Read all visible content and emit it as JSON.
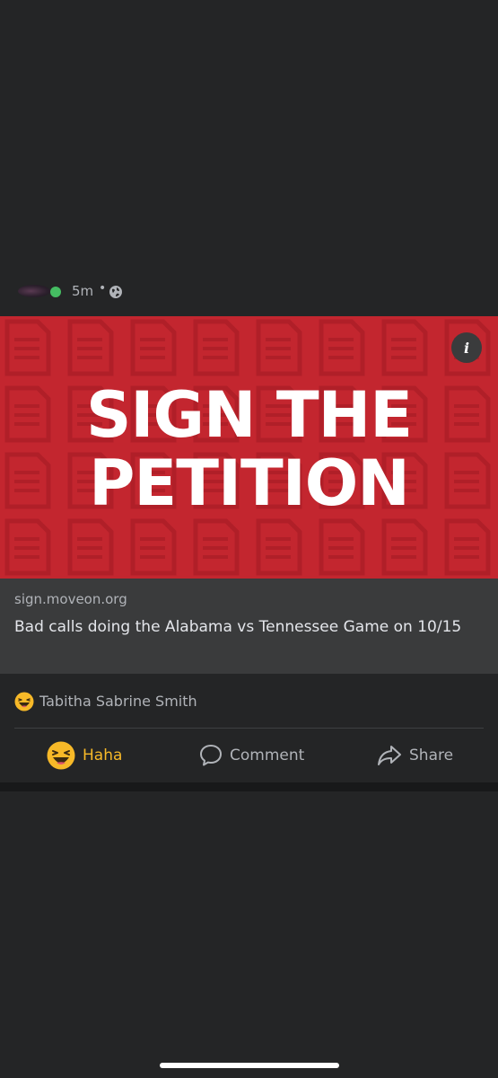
{
  "post": {
    "timestamp": "5m",
    "separator": "•",
    "privacy_icon": "globe-icon",
    "online_color": "#45bd62"
  },
  "banner": {
    "line1": "SIGN THE",
    "line2": "PETITION",
    "background": "#c3262f",
    "info_icon": "i"
  },
  "link": {
    "domain": "sign.moveon.org",
    "title": "Bad calls doing the Alabama vs Tennessee Game on 10/15"
  },
  "reactions": {
    "icon": "haha-emoji-icon",
    "names": "Tabitha Sabrine Smith"
  },
  "actions": {
    "haha_label": "Haha",
    "comment_label": "Comment",
    "share_label": "Share",
    "haha_color": "#f7b928"
  }
}
